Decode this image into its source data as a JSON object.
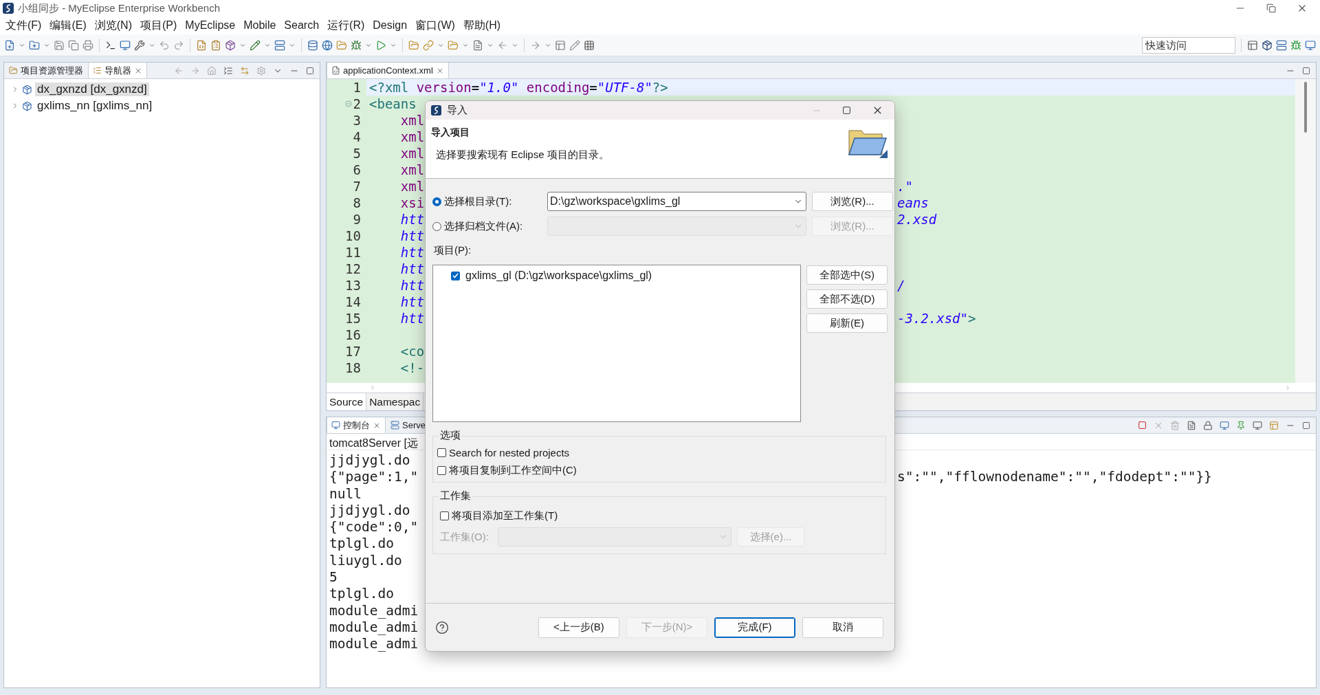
{
  "window": {
    "title": "小组同步 - MyEclipse Enterprise Workbench"
  },
  "menu": [
    "文件(F)",
    "编辑(E)",
    "浏览(N)",
    "项目(P)",
    "MyEclipse",
    "Mobile",
    "Search",
    "运行(R)",
    "Design",
    "窗口(W)",
    "帮助(H)"
  ],
  "quick_access": {
    "placeholder": "快速访问"
  },
  "left_panel": {
    "tabs": [
      {
        "label": "项目资源管理器",
        "selected": false,
        "closable": false
      },
      {
        "label": "导航器",
        "selected": true,
        "closable": true
      }
    ],
    "tree": [
      {
        "label": "dx_gxnzd [dx_gxnzd]",
        "selected": true
      },
      {
        "label": "gxlims_nn [gxlims_nn]",
        "selected": false
      }
    ]
  },
  "editor": {
    "tabs": [
      {
        "label": "applicationContext.xml",
        "selected": true
      }
    ],
    "lines": [
      {
        "number": "1",
        "current": true,
        "fold": false,
        "segments": [
          {
            "text": "<?xml",
            "kind": "tag"
          },
          {
            "text": " version",
            "kind": "attr"
          },
          {
            "text": "=",
            "kind": "plain"
          },
          {
            "text": "\"1.0\"",
            "kind": "value"
          },
          {
            "text": " encoding",
            "kind": "attr"
          },
          {
            "text": "=",
            "kind": "plain"
          },
          {
            "text": "\"UTF-8\"",
            "kind": "value"
          },
          {
            "text": "?>",
            "kind": "tag"
          }
        ]
      },
      {
        "number": "2",
        "current": false,
        "fold": true,
        "segments": [
          {
            "text": "<beans",
            "kind": "tag"
          }
        ]
      },
      {
        "number": "3",
        "current": false,
        "fold": false,
        "segments": [
          {
            "text": "    xml",
            "kind": "attr"
          }
        ]
      },
      {
        "number": "4",
        "current": false,
        "fold": false,
        "segments": [
          {
            "text": "    xml",
            "kind": "attr"
          }
        ]
      },
      {
        "number": "5",
        "current": false,
        "fold": false,
        "segments": [
          {
            "text": "    xml",
            "kind": "attr"
          }
        ]
      },
      {
        "number": "6",
        "current": false,
        "fold": false,
        "segments": [
          {
            "text": "    xml",
            "kind": "attr"
          }
        ]
      },
      {
        "number": "7",
        "current": false,
        "fold": false,
        "segments": [
          {
            "text": "    xml",
            "kind": "attr"
          }
        ],
        "tail": [
          {
            "text": ".\"",
            "kind": "value"
          }
        ]
      },
      {
        "number": "8",
        "current": false,
        "fold": false,
        "segments": [
          {
            "text": "    xsi",
            "kind": "attr"
          }
        ],
        "tail": [
          {
            "text": "eans",
            "kind": "value"
          }
        ]
      },
      {
        "number": "9",
        "current": false,
        "fold": false,
        "segments": [
          {
            "text": "    htt",
            "kind": "value"
          }
        ],
        "tail": [
          {
            "text": "2.xsd",
            "kind": "value"
          }
        ]
      },
      {
        "number": "10",
        "current": false,
        "fold": false,
        "segments": [
          {
            "text": "    htt",
            "kind": "value"
          }
        ]
      },
      {
        "number": "11",
        "current": false,
        "fold": false,
        "segments": [
          {
            "text": "    htt",
            "kind": "value"
          }
        ]
      },
      {
        "number": "12",
        "current": false,
        "fold": false,
        "segments": [
          {
            "text": "    htt",
            "kind": "value"
          }
        ]
      },
      {
        "number": "13",
        "current": false,
        "fold": false,
        "segments": [
          {
            "text": "    htt",
            "kind": "value"
          }
        ],
        "tail": [
          {
            "text": "/",
            "kind": "value"
          }
        ]
      },
      {
        "number": "14",
        "current": false,
        "fold": false,
        "segments": [
          {
            "text": "    htt",
            "kind": "value"
          }
        ]
      },
      {
        "number": "15",
        "current": false,
        "fold": false,
        "segments": [
          {
            "text": "    htt",
            "kind": "value"
          }
        ],
        "tail": [
          {
            "text": "-3.2.xsd\"",
            "kind": "value"
          },
          {
            "text": ">",
            "kind": "tag"
          }
        ]
      },
      {
        "number": "16",
        "current": false,
        "fold": false
      },
      {
        "number": "17",
        "current": false,
        "fold": false,
        "segments": [
          {
            "text": "    <co",
            "kind": "tag"
          }
        ]
      },
      {
        "number": "18",
        "current": false,
        "fold": false,
        "segments": [
          {
            "text": "    <!-",
            "kind": "tag"
          }
        ]
      }
    ],
    "bottom_tabs": [
      {
        "label": "Source",
        "selected": true
      },
      {
        "label": "Namespac",
        "selected": false
      }
    ]
  },
  "console": {
    "tabs": [
      {
        "label": "控制台",
        "selected": true,
        "closable": true
      },
      {
        "label": "Serve",
        "selected": false,
        "closable": false
      }
    ],
    "header": "tomcat8Server [远",
    "lines": [
      {
        "text": "jjdjygl.do"
      },
      {
        "text": "{\"page\":1,\"",
        "tail": "s\":\"\",\"fflownodename\":\"\",\"fdodept\":\"\"}}"
      },
      {
        "text": "null"
      },
      {
        "text": "jjdjygl.do"
      },
      {
        "text": "{\"code\":0,\""
      },
      {
        "text": "tplgl.do"
      },
      {
        "text": "liuygl.do"
      },
      {
        "text": "5"
      },
      {
        "text": "tplgl.do"
      },
      {
        "text": "module_admi"
      },
      {
        "text": "module_admi"
      },
      {
        "text": "module_admi"
      }
    ]
  },
  "dialog": {
    "title": "导入",
    "heading": "导入项目",
    "description": "选择要搜索现有 Eclipse 项目的目录。",
    "sources": [
      {
        "label": "选择根目录(T):",
        "selected": true,
        "value": "D:\\gz\\workspace\\gxlims_gl",
        "button": "浏览(R)...",
        "disabled": false
      },
      {
        "label": "选择归档文件(A):",
        "selected": false,
        "button": "浏览(R)...",
        "disabled": true
      }
    ],
    "projects_label": "项目(P):",
    "projects": [
      {
        "label": "gxlims_gl (D:\\gz\\workspace\\gxlims_gl)",
        "checked": true
      }
    ],
    "list_buttons": [
      "全部选中(S)",
      "全部不选(D)",
      "刷新(E)"
    ],
    "options": {
      "title": "选项",
      "items": [
        {
          "label": "Search for nested projects",
          "checked": false
        },
        {
          "label": "将项目复制到工作空间中(C)",
          "checked": false
        }
      ]
    },
    "working_set": {
      "title": "工作集",
      "checkbox": {
        "label": "将项目添加至工作集(T)",
        "checked": false
      },
      "field_label": "工作集(O):",
      "button": "选择(e)...",
      "disabled": true
    },
    "buttons": [
      {
        "label": "<上一步(B)",
        "disabled": false,
        "default": false
      },
      {
        "label": "下一步(N)>",
        "disabled": true,
        "default": false
      },
      {
        "label": "完成(F)",
        "disabled": false,
        "default": true
      },
      {
        "label": "取消",
        "disabled": false,
        "default": false
      }
    ]
  }
}
